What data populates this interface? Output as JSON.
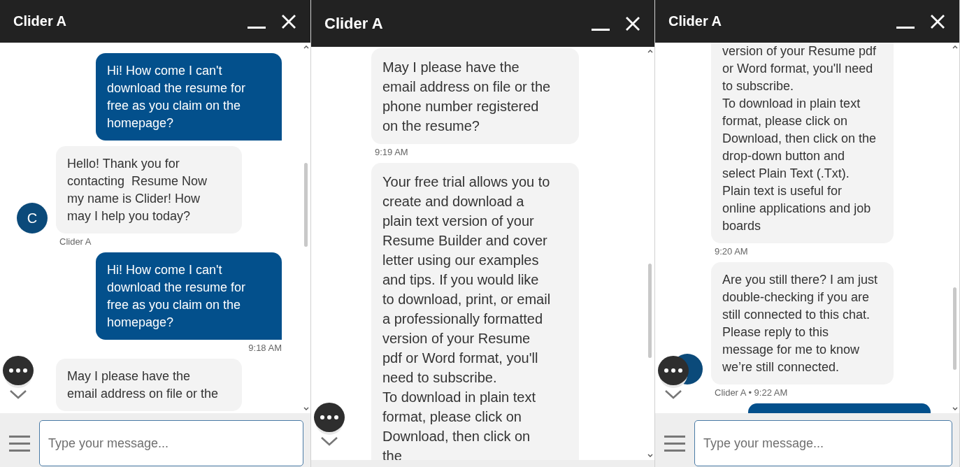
{
  "panels": [
    {
      "title": "Clider A",
      "composer": {
        "placeholder": "Type your message..."
      },
      "messages": [
        {
          "kind": "user",
          "text": "Hi! How come I can't download the resume for free as you claim on the homepage?"
        },
        {
          "kind": "agent",
          "text": "Hello! Thank you for contacting  Resume Now my name is Clider! How may I help you today?",
          "avatar": true,
          "avatar_letter": "C",
          "meta": "Clider A"
        },
        {
          "kind": "user",
          "text": "Hi! How come I can't download the resume for free as you claim on the homepage?",
          "meta": "9:18 AM"
        },
        {
          "kind": "agent",
          "text": "May I please have the email address on file or the"
        }
      ]
    },
    {
      "title": "Clider A",
      "messages": [
        {
          "kind": "agent",
          "text": "May I please have the email address on file or the phone number registered on the resume?",
          "meta": "9:19 AM"
        },
        {
          "kind": "agent",
          "text": "Your free trial allows you to create and download a plain text version of your Resume Builder and cover letter using our examples and tips. If you would like to download, print, or email a professionally formatted version of your Resume pdf or Word format, you'll need to subscribe.\nTo download in plain text format, please click on Download, then click on the"
        }
      ]
    },
    {
      "title": "Clider A",
      "composer": {
        "placeholder": "Type your message..."
      },
      "messages": [
        {
          "kind": "agent",
          "text": "version of your Resume pdf or Word format, you'll need to subscribe.\nTo download in plain text format, please click on Download, then click on the drop-down button and select Plain Text (.Txt). Plain text is useful for online applications and job boards",
          "meta": "9:20 AM"
        },
        {
          "kind": "agent",
          "text": "Are you still there? I am just double-checking if you are still connected to this chat. Please reply to this message for me to know we’re still connected.",
          "avatar": true,
          "meta": "Clider A • 9:22 AM"
        },
        {
          "kind": "user"
        }
      ]
    }
  ]
}
